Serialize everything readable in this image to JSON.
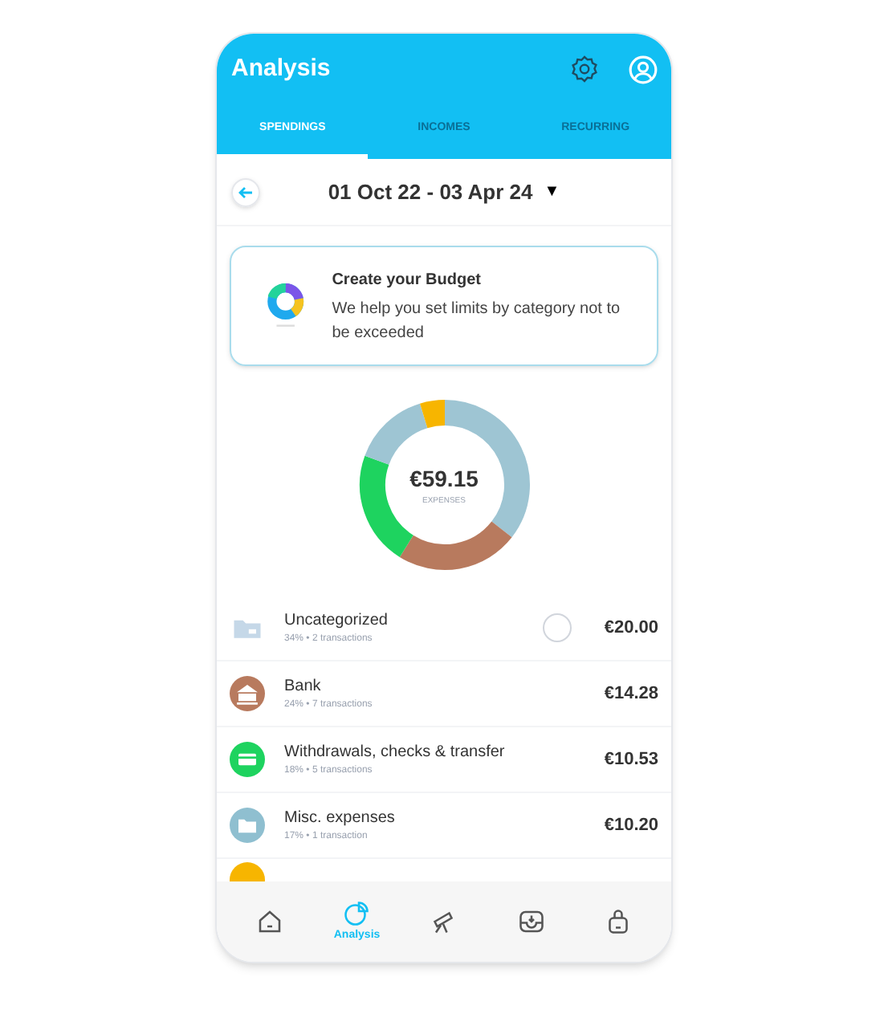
{
  "header": {
    "title": "Analysis"
  },
  "tabs": [
    {
      "label": "SPENDINGS",
      "selected": true
    },
    {
      "label": "INCOMES",
      "selected": false
    },
    {
      "label": "RECURRING",
      "selected": false
    }
  ],
  "date_range": {
    "label": "01 Oct 22 - 03 Apr 24",
    "caret": "▼"
  },
  "budget_card": {
    "title": "Create your Budget",
    "text": "We help you set limits by category not to be exceeded"
  },
  "summary": {
    "amount": "€59.15",
    "caption": "EXPENSES"
  },
  "categories": [
    {
      "kind": "folder",
      "name": "Uncategorized",
      "detail": "34% • 2 transactions",
      "amount": "€20.00",
      "color": "#c5d8e8",
      "radio_checked": false
    },
    {
      "kind": "bank",
      "name": "Bank",
      "detail": "24% • 7 transactions",
      "amount": "€14.28",
      "color": "#b87a5e"
    },
    {
      "kind": "card",
      "name": "Withdrawals, checks & transfer",
      "detail": "18% • 5 transactions",
      "amount": "€10.53",
      "color": "#1ed35f"
    },
    {
      "kind": "folder-circle",
      "name": "Misc. expenses",
      "detail": "17% • 1 transaction",
      "amount": "€10.20",
      "color": "#8fbfd0"
    },
    {
      "kind": "partial",
      "color": "#f7b500"
    }
  ],
  "bottom_nav": [
    {
      "selected": false
    },
    {
      "label": "Analysis",
      "selected": true
    },
    {
      "selected": false
    },
    {
      "selected": false
    },
    {
      "selected": false
    }
  ]
}
